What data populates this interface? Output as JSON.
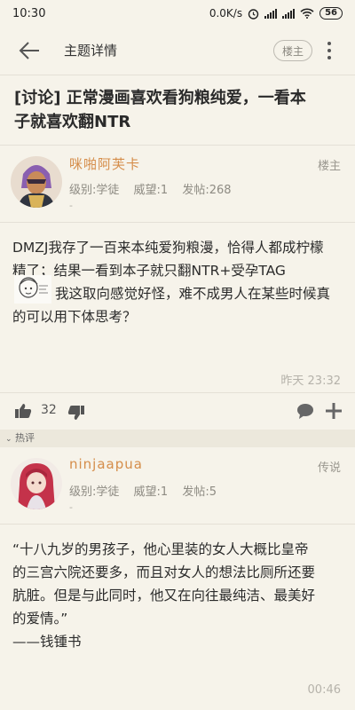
{
  "status": {
    "time": "10:30",
    "speed": "0.0K/s",
    "battery": "56"
  },
  "app_bar": {
    "title": "主题详情",
    "op_badge": "楼主"
  },
  "thread": {
    "title_line1": "[讨论] 正常漫画喜欢看狗粮纯爱，一看本",
    "title_line2": "子就喜欢翻NTR"
  },
  "post1": {
    "username": "咪啪阿芙卡",
    "role": "楼主",
    "level": "级别:学徒",
    "prestige": "威望:1",
    "posts": "发帖:268",
    "signature": "-",
    "lines": [
      "DMZJ我存了一百来本纯爱狗粮漫，恰得人都成柠檬",
      "精了；结果一看到本子就只翻NTR+受孕TAG",
      "我这取向感觉好怪，难不成男人在某些时候真",
      "的可以用下体思考？"
    ],
    "time": "昨天 23:32",
    "likes": "32"
  },
  "hot_label": "热评",
  "post2": {
    "username": "ninjaapua",
    "role": "传说",
    "level": "级别:学徒",
    "prestige": "威望:1",
    "posts": "发帖:5",
    "signature": "-",
    "lines": [
      "“十八九岁的男孩子，他心里装的女人大概比皇帝",
      "的三宫六院还要多，而且对女人的想法比厕所还要",
      "肮脏。但是与此同时，他又在向往最纯洁、最美好",
      "的爱情。”",
      "——钱锺书"
    ],
    "time": "00:46"
  },
  "colors": {
    "background": "#f6f3ea",
    "username": "#d58d4a",
    "meta": "#8e8b83"
  }
}
